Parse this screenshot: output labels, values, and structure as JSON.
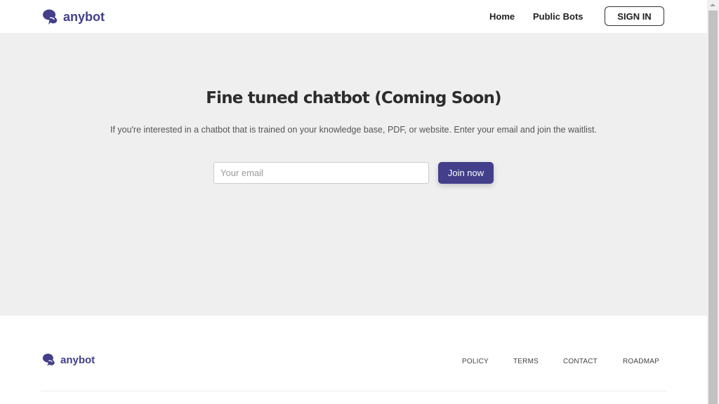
{
  "brand": {
    "name": "anybot",
    "color": "#433f8a"
  },
  "nav": {
    "links": [
      "Home",
      "Public Bots"
    ],
    "signin_label": "SIGN IN"
  },
  "hero": {
    "title": "Fine tuned chatbot (Coming Soon)",
    "subtitle": "If you're interested in a chatbot that is trained on your knowledge base, PDF, or website. Enter your email and join the waitlist.",
    "email_placeholder": "Your email",
    "email_value": "",
    "join_label": "Join now"
  },
  "footer": {
    "links": [
      "POLICY",
      "TERMS",
      "CONTACT",
      "ROADMAP"
    ]
  }
}
